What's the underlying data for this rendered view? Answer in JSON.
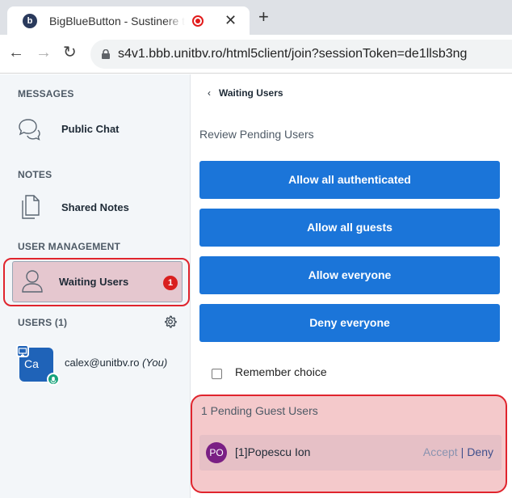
{
  "browser": {
    "tab_title": "BigBlueButton - Sustinere teze",
    "tab_close": "✕",
    "new_tab": "+",
    "url": "s4v1.bbb.unitbv.ro/html5client/join?sessionToken=de1llsb3ng"
  },
  "sidebar": {
    "messages_title": "MESSAGES",
    "public_chat": "Public Chat",
    "notes_title": "NOTES",
    "shared_notes": "Shared Notes",
    "user_mgmt_title": "USER MANAGEMENT",
    "waiting_users": "Waiting Users",
    "waiting_badge": "1",
    "users_title": "USERS (1)",
    "user": {
      "initials": "Ca",
      "name": "calex@unitbv.ro",
      "you": "(You)"
    }
  },
  "panel": {
    "back_label": "Waiting Users",
    "subtitle": "Review Pending Users",
    "buttons": {
      "allow_authenticated": "Allow all authenticated",
      "allow_guests": "Allow all guests",
      "allow_everyone": "Allow everyone",
      "deny_everyone": "Deny everyone"
    },
    "remember_choice": "Remember choice",
    "pending_title": "1 Pending Guest Users",
    "guest": {
      "initials": "PO",
      "name": "[1]Popescu Ion",
      "accept": "Accept",
      "separator": "|",
      "deny": "Deny"
    }
  },
  "colors": {
    "primary": "#1b75d9",
    "badge": "#d91f1f",
    "highlight_outline": "#e0242d",
    "guest_avatar": "#7a1f84"
  }
}
